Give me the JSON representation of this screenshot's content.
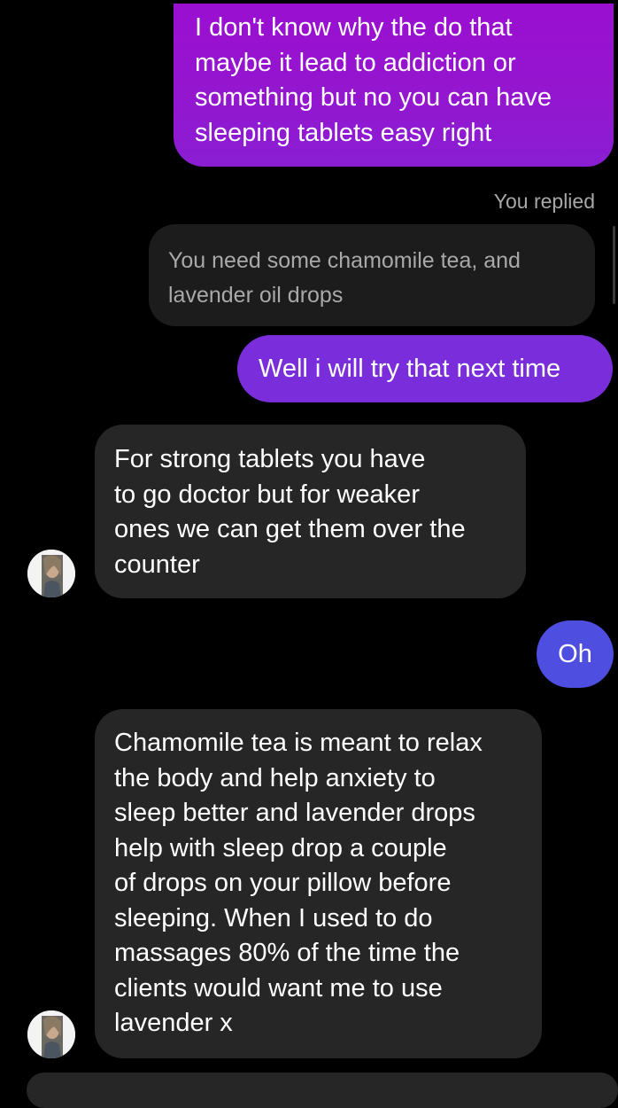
{
  "conversation": {
    "messages": [
      {
        "sender": "me",
        "text": "I don't know why the do that\nmaybe it lead to addiction or\nsomething but no you can have\nsleeping tablets easy right"
      },
      {
        "sender": "me",
        "reply_label": "You replied",
        "quoted_text": "You need some chamomile tea, and\nlavender oil drops"
      },
      {
        "sender": "me",
        "text": "Well i will try that next time"
      },
      {
        "sender": "them",
        "text": "For strong tablets you have\nto go doctor but for weaker\nones we can get them over the\ncounter"
      },
      {
        "sender": "me",
        "text": "Oh"
      },
      {
        "sender": "them",
        "text": "Chamomile tea is meant to relax\nthe body and help anxiety to\nsleep better and lavender drops\nhelp with sleep drop a couple\nof drops on your pillow before\nsleeping. When I used to do\nmassages 80% of the time the\nclients would want me to use\nlavender x"
      }
    ]
  },
  "colors": {
    "background": "#000000",
    "sent_bubble_top": "#9a0fd0",
    "sent_bubble_mid": "#7a2edb",
    "sent_bubble_bottom": "#4e4ee0",
    "received_bubble": "#262626",
    "quoted_bubble": "#1c1c1c",
    "muted_text": "#a8a8a8"
  },
  "icons": {
    "contact_avatar": "profile-photo"
  }
}
